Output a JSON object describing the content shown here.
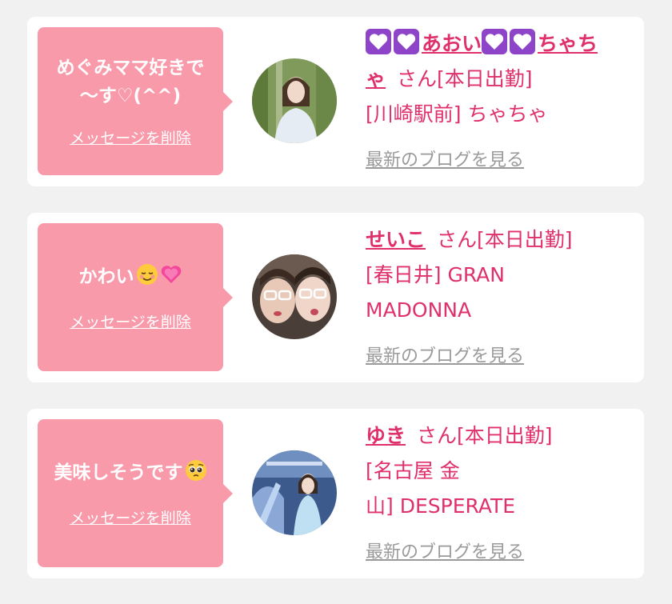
{
  "cards": [
    {
      "message_line1": "めぐみママ好きで",
      "message_line2": "〜す♡(^^)",
      "delete_label": "メッセージを削除",
      "name_part1": "あおい",
      "name_part2": "ちゃち",
      "name_part3": "ゃ",
      "name_suffix": "さん[本日出勤]",
      "shop": "[川崎駅前] ちゃちゃ",
      "blog_label": "最新のブログを見る"
    },
    {
      "message": "かわい",
      "message_emojis": [
        "relieved-face-emoji",
        "growing-heart-emoji"
      ],
      "delete_label": "メッセージを削除",
      "name": "せいこ",
      "name_suffix": "さん[本日出勤]",
      "shop_line1": "[春日井] GRAN",
      "shop_line2": "MADONNA",
      "blog_label": "最新のブログを見る"
    },
    {
      "message": "美味しそうです",
      "message_emojis": [
        "pleading-face-emoji"
      ],
      "delete_label": "メッセージを削除",
      "name": "ゆき",
      "name_suffix": "さん[本日出勤]",
      "shop_line1": "[名古屋 金",
      "shop_line2": "山] DESPERATE",
      "blog_label": "最新のブログを見る"
    }
  ],
  "colors": {
    "bubble": "#f99aab",
    "name": "#e0306b",
    "link_gray": "#9a9a9a",
    "heart_badge": "#8e44c8"
  }
}
